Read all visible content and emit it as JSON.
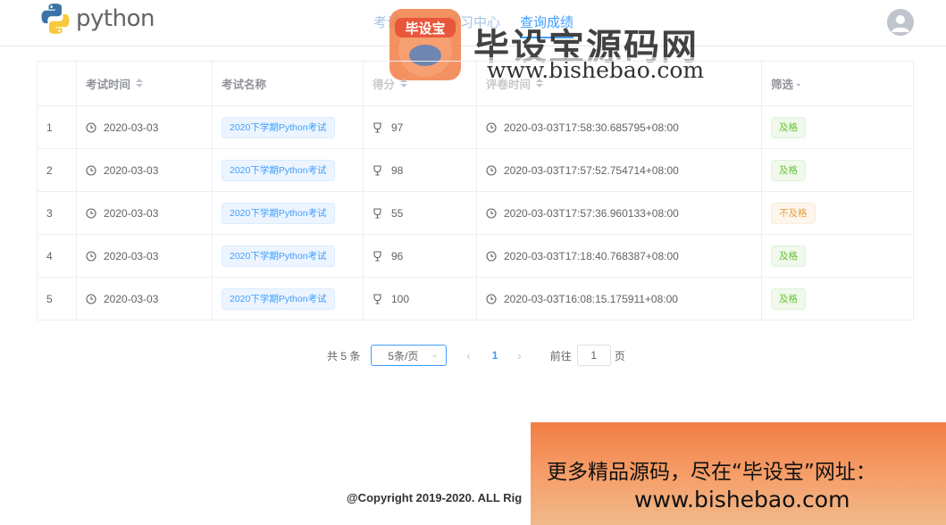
{
  "header": {
    "logo_text": "python",
    "nav": [
      "考试中心",
      "练习中心",
      "查询成绩"
    ],
    "active_nav": 2
  },
  "watermark": {
    "badge_text": "毕设宝",
    "title": "毕设宝源码网",
    "url": "www.bishebao.com"
  },
  "table": {
    "columns": [
      "",
      "考试时间",
      "考试名称",
      "得分",
      "评卷时间",
      "筛选"
    ],
    "rows": [
      {
        "index": "1",
        "exam_time": "2020-03-03",
        "exam_name": "2020下学期Python考试",
        "score": "97",
        "review_time": "2020-03-03T17:58:30.685795+08:00",
        "status": "及格"
      },
      {
        "index": "2",
        "exam_time": "2020-03-03",
        "exam_name": "2020下学期Python考试",
        "score": "98",
        "review_time": "2020-03-03T17:57:52.754714+08:00",
        "status": "及格"
      },
      {
        "index": "3",
        "exam_time": "2020-03-03",
        "exam_name": "2020下学期Python考试",
        "score": "55",
        "review_time": "2020-03-03T17:57:36.960133+08:00",
        "status": "不及格"
      },
      {
        "index": "4",
        "exam_time": "2020-03-03",
        "exam_name": "2020下学期Python考试",
        "score": "96",
        "review_time": "2020-03-03T17:18:40.768387+08:00",
        "status": "及格"
      },
      {
        "index": "5",
        "exam_time": "2020-03-03",
        "exam_name": "2020下学期Python考试",
        "score": "100",
        "review_time": "2020-03-03T16:08:15.175911+08:00",
        "status": "及格"
      }
    ]
  },
  "pagination": {
    "total": "共 5 条",
    "page_size": "5条/页",
    "prev": "‹",
    "current": "1",
    "next": "›",
    "goto_label": "前往",
    "goto_value": "1",
    "goto_unit": "页"
  },
  "footer": {
    "copyright": "@Copyright 2019-2020. ALL Rig"
  },
  "banner": {
    "line1": "更多精品源码，尽在“毕设宝”网址：",
    "line2": "www.bishebao.com"
  },
  "colors": {
    "primary": "#409eff",
    "pass": "#67c23a",
    "fail": "#e6a23c",
    "banner": "#f27e45"
  }
}
